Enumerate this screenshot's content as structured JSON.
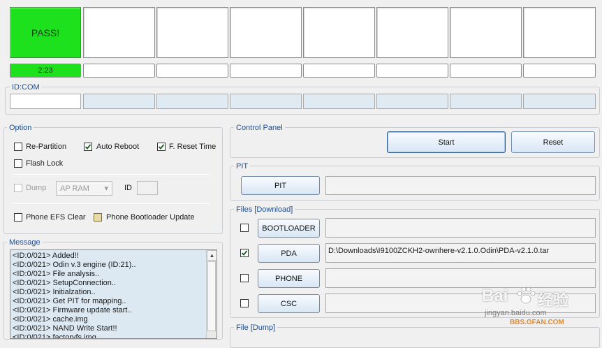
{
  "ports": {
    "status": [
      "PASS!",
      "",
      "",
      "",
      "",
      "",
      "",
      ""
    ],
    "timers": [
      "2:23",
      "",
      "",
      "",
      "",
      "",
      "",
      ""
    ]
  },
  "idcom": {
    "label": "ID:COM"
  },
  "option": {
    "title": "Option",
    "repartition": {
      "label": "Re-Partition",
      "checked": false
    },
    "auto_reboot": {
      "label": "Auto Reboot",
      "checked": true
    },
    "f_reset_time": {
      "label": "F. Reset Time",
      "checked": true
    },
    "flash_lock": {
      "label": "Flash Lock",
      "checked": false
    },
    "dump": {
      "label": "Dump",
      "checked": false,
      "select_value": "AP RAM",
      "id_label": "ID"
    },
    "phone_efs_clear": {
      "label": "Phone EFS Clear",
      "checked": false
    },
    "phone_bootloader_update": {
      "label": "Phone Bootloader Update",
      "checked": false
    }
  },
  "message": {
    "title": "Message",
    "lines": [
      "<ID:0/021> Added!!",
      "<ID:0/021> Odin v.3 engine (ID:21)..",
      "<ID:0/021> File analysis..",
      "<ID:0/021> SetupConnection..",
      "<ID:0/021> Initialzation..",
      "<ID:0/021> Get PIT for mapping..",
      "<ID:0/021> Firmware update start..",
      "<ID:0/021> cache.img",
      "<ID:0/021> NAND Write Start!!",
      "<ID:0/021> factoryfs.img"
    ]
  },
  "control_panel": {
    "title": "Control Panel",
    "start_label": "Start",
    "reset_label": "Reset"
  },
  "pit": {
    "title": "PIT",
    "button_label": "PIT",
    "path": ""
  },
  "files": {
    "title": "Files [Download]",
    "rows": [
      {
        "label": "BOOTLOADER",
        "checked": false,
        "path": ""
      },
      {
        "label": "PDA",
        "checked": true,
        "path": "D:\\Downloads\\I9100ZCKH2-ownhere-v2.1.0.Odin\\PDA-v2.1.0.tar"
      },
      {
        "label": "PHONE",
        "checked": false,
        "path": ""
      },
      {
        "label": "CSC",
        "checked": false,
        "path": ""
      }
    ]
  },
  "file_dump": {
    "title": "File [Dump]"
  },
  "watermark": {
    "brand": "Bai",
    "brand2": "经验",
    "url": "jingyan.baidu.com",
    "site": "BBS.GFAN.COM"
  }
}
